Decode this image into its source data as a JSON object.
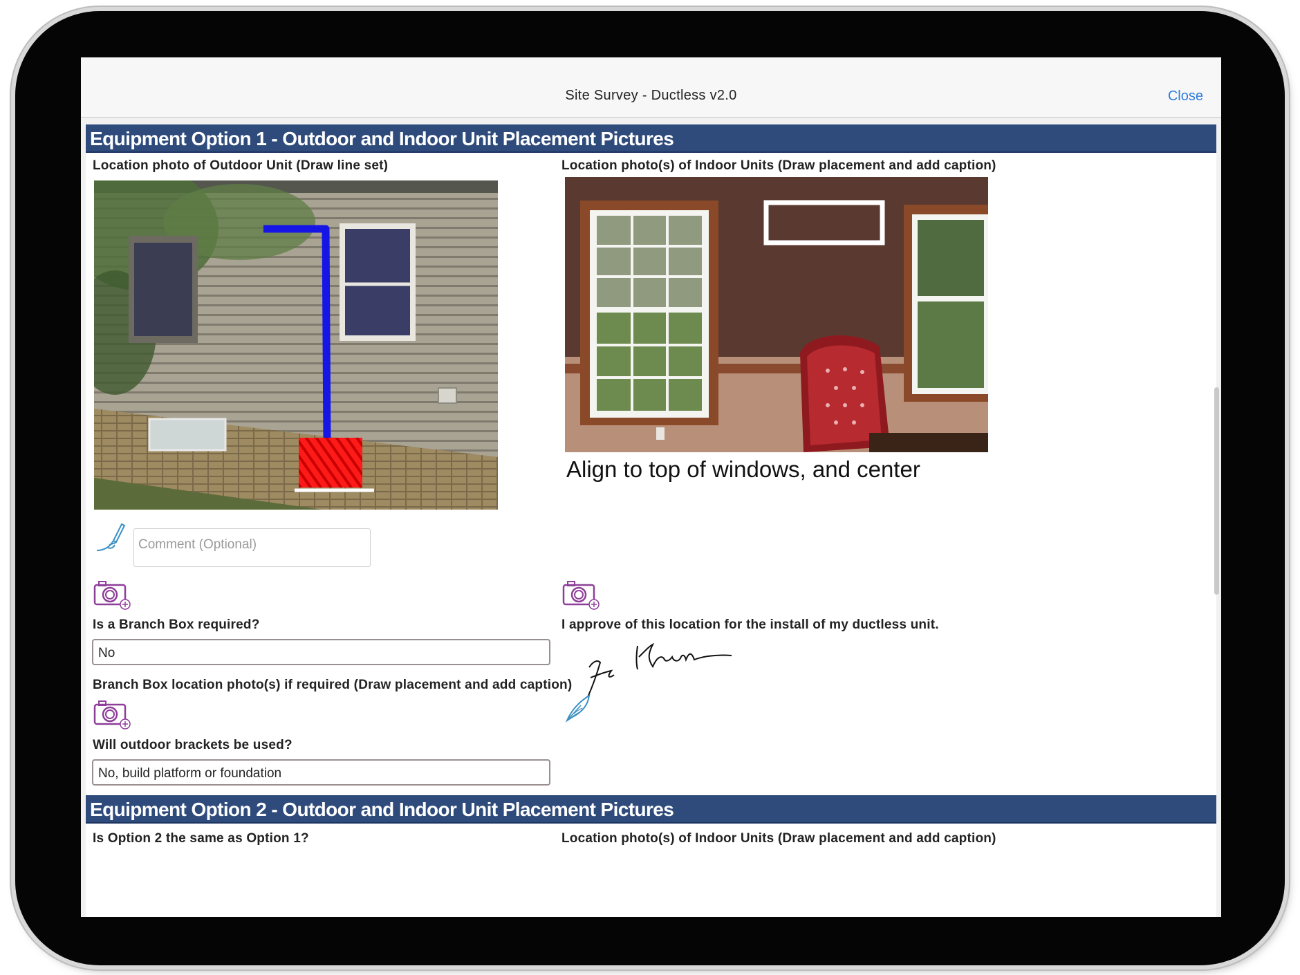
{
  "window": {
    "title": "Site Survey - Ductless v2.0",
    "close_label": "Close"
  },
  "option1": {
    "header": "Equipment Option 1 - Outdoor and Indoor Unit Placement Pictures",
    "outdoor_photo_label": "Location photo of Outdoor Unit (Draw line set)",
    "indoor_photo_label": "Location photo(s) of Indoor Units  (Draw placement and add caption)",
    "comment_placeholder": "Comment (Optional)",
    "indoor_caption": "Align to top of windows, and center",
    "branch_box_label": "Is a Branch Box required?",
    "branch_box_value": "No",
    "branch_box_photo_label": "Branch Box location photo(s) if required (Draw placement and add caption)",
    "brackets_label": "Will outdoor brackets be used?",
    "brackets_value": "No, build platform or foundation",
    "approval_label": "I approve of this location for the install of my ductless unit."
  },
  "option2": {
    "header": "Equipment Option 2 - Outdoor and Indoor Unit Placement Pictures",
    "same_label": "Is Option 2 the same as Option 1?",
    "indoor_photo_label": "Location photo(s) of Indoor Units (Draw placement and add caption)"
  },
  "icons": {
    "draw": "pen-brush-icon",
    "camera": "camera-add-icon",
    "signature_pen": "quill-pen-icon"
  },
  "colors": {
    "section_header": "#2e4b7b",
    "link": "#2f7bd9",
    "camera_icon": "#8e3f99",
    "draw_icon": "#3a8fc4",
    "line_set_markup": "#1515e6",
    "unit_markup": "#ff1a1a"
  }
}
